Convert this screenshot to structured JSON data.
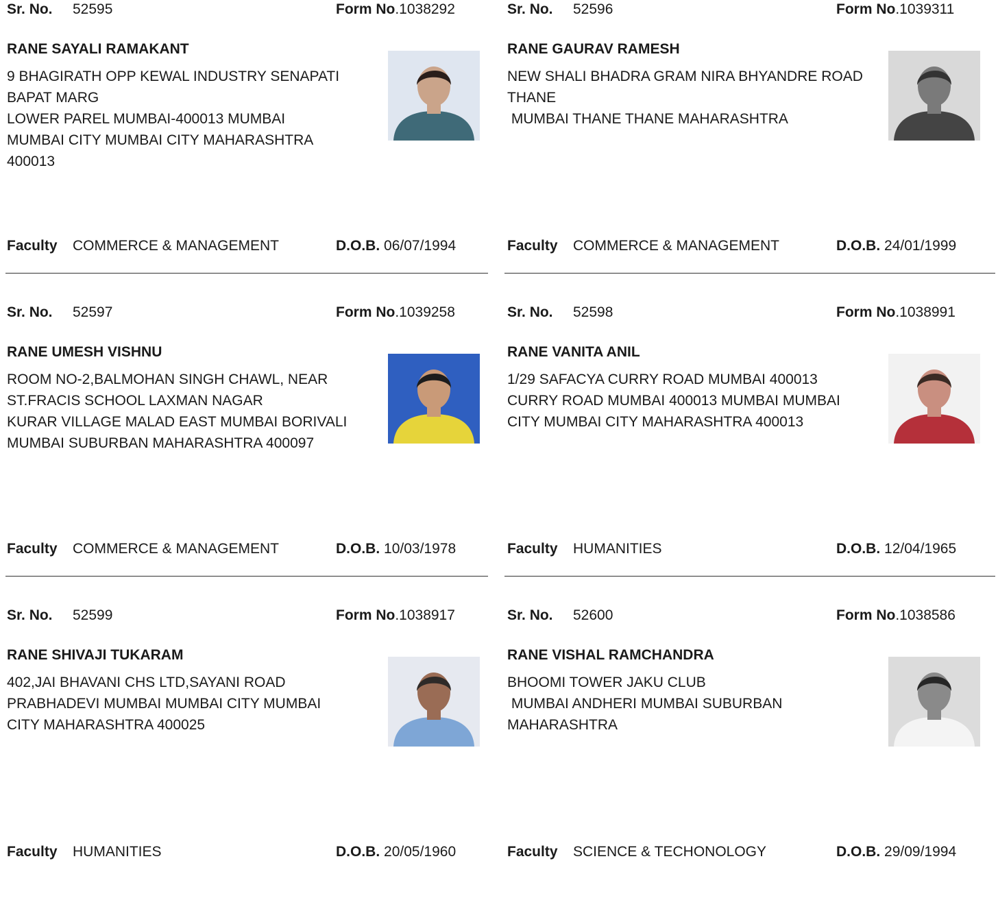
{
  "labels": {
    "sr_no": "Sr. No.",
    "form_no": "Form No",
    "faculty": "Faculty",
    "dob": "D.O.B."
  },
  "records": [
    {
      "sr_no": "52595",
      "form_no": ".1038292",
      "name": "RANE SAYALI RAMAKANT",
      "address_lines": [
        "9 BHAGIRATH OPP KEWAL INDUSTRY SENAPATI",
        "BAPAT MARG",
        "LOWER PAREL MUMBAI-400013 MUMBAI",
        "MUMBAI CITY MUMBAI CITY MAHARASHTRA",
        "400013"
      ],
      "faculty": "COMMERCE & MANAGEMENT",
      "dob": "06/07/1994",
      "photo": {
        "bg": "#dfe6f0",
        "skin": "#caa48a",
        "hair": "#2a1e1a",
        "shirt": "#3f6a78"
      }
    },
    {
      "sr_no": "52596",
      "form_no": ".1039311",
      "name": "RANE GAURAV RAMESH",
      "address_lines": [
        "NEW SHALI BHADRA GRAM NIRA BHYANDRE ROAD",
        "THANE",
        " MUMBAI THANE THANE MAHARASHTRA"
      ],
      "faculty": "COMMERCE & MANAGEMENT",
      "dob": "24/01/1999",
      "photo": {
        "bg": "#d9d9d9",
        "skin": "#7a7a7a",
        "hair": "#333333",
        "shirt": "#444444"
      }
    },
    {
      "sr_no": "52597",
      "form_no": ".1039258",
      "name": "RANE UMESH VISHNU",
      "address_lines": [
        "ROOM NO-2,BALMOHAN SINGH CHAWL, NEAR",
        "ST.FRACIS SCHOOL LAXMAN NAGAR",
        "KURAR VILLAGE MALAD EAST MUMBAI BORIVALI",
        "MUMBAI SUBURBAN MAHARASHTRA 400097"
      ],
      "faculty": "COMMERCE & MANAGEMENT",
      "dob": "10/03/1978",
      "photo": {
        "bg": "#2f5fc0",
        "skin": "#c99a78",
        "hair": "#1c1c1c",
        "shirt": "#e6d43a"
      }
    },
    {
      "sr_no": "52598",
      "form_no": ".1038991",
      "name": "RANE VANITA ANIL",
      "address_lines": [
        "1/29 SAFACYA CURRY ROAD MUMBAI 400013",
        "CURRY ROAD MUMBAI 400013 MUMBAI MUMBAI",
        "CITY MUMBAI CITY MAHARASHTRA 400013"
      ],
      "faculty": "HUMANITIES",
      "dob": "12/04/1965",
      "photo": {
        "bg": "#f2f2f2",
        "skin": "#c98f80",
        "hair": "#3a2a24",
        "shirt": "#b5303a"
      }
    },
    {
      "sr_no": "52599",
      "form_no": ".1038917",
      "name": "RANE SHIVAJI TUKARAM",
      "address_lines": [
        "402,JAI BHAVANI CHS LTD,SAYANI ROAD",
        "PRABHADEVI MUMBAI MUMBAI CITY MUMBAI",
        "CITY MAHARASHTRA 400025"
      ],
      "faculty": "HUMANITIES",
      "dob": "20/05/1960",
      "photo": {
        "bg": "#e6e9f0",
        "skin": "#9a6c55",
        "hair": "#2e2a28",
        "shirt": "#7ea6d6"
      }
    },
    {
      "sr_no": "52600",
      "form_no": ".1038586",
      "name": "RANE VISHAL RAMCHANDRA",
      "address_lines": [
        "BHOOMI TOWER JAKU CLUB",
        " MUMBAI ANDHERI MUMBAI SUBURBAN",
        "MAHARASHTRA"
      ],
      "faculty": "SCIENCE & TECHONOLOGY",
      "dob": "29/09/1994",
      "photo": {
        "bg": "#dcdcdc",
        "skin": "#8a8a8a",
        "hair": "#262626",
        "shirt": "#f4f4f4"
      }
    }
  ]
}
